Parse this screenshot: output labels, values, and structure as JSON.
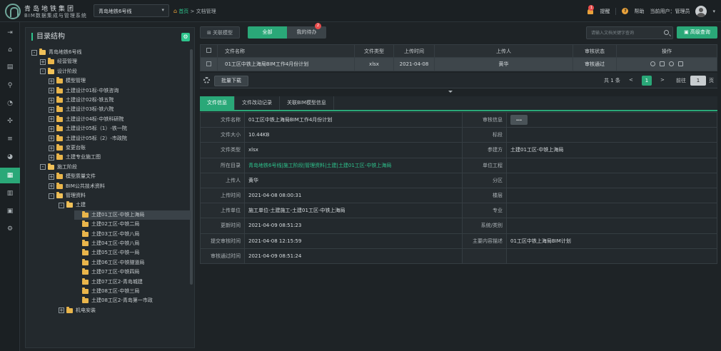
{
  "header": {
    "brand_cn": "青岛地铁集团",
    "brand_sub": "BIM数据集成与管理系统",
    "project": "青岛地铁6号线",
    "breadcrumb": {
      "home": "首页",
      "sep": ">",
      "current": "文档管理"
    },
    "notify_count": "1",
    "notify_label": "提醒",
    "help_label": "帮助",
    "user_label": "当前用户：管理员"
  },
  "rail": {
    "items": [
      "menu-icon",
      "home-icon",
      "chart-icon",
      "flow-icon",
      "gauge-icon",
      "sliders-icon",
      "pie-icon",
      "doc-icon",
      "bar-icon",
      "image-icon",
      "settings-icon"
    ],
    "active_index": 7
  },
  "tree": {
    "title": "目录结构",
    "nodes": [
      {
        "label": "青岛地铁6号线",
        "level": 0,
        "toggle": "-",
        "open": true
      },
      {
        "label": "经营管理",
        "level": 1,
        "toggle": "+"
      },
      {
        "label": "设计阶段",
        "level": 1,
        "toggle": "-",
        "open": true
      },
      {
        "label": "模型管理",
        "level": 2,
        "toggle": "+"
      },
      {
        "label": "土建设计01标-中铁咨询",
        "level": 2,
        "toggle": "+"
      },
      {
        "label": "土建设计02标-铁五院",
        "level": 2,
        "toggle": "+"
      },
      {
        "label": "土建设计03标-铁六院",
        "level": 2,
        "toggle": "+"
      },
      {
        "label": "土建设计04标-中铁科研院",
        "level": 2,
        "toggle": "+"
      },
      {
        "label": "土建设计05标（1）-铁一院",
        "level": 2,
        "toggle": "+"
      },
      {
        "label": "土建设计05标（2）-市政院",
        "level": 2,
        "toggle": "+"
      },
      {
        "label": "变更台账",
        "level": 2,
        "toggle": "+"
      },
      {
        "label": "土建专业施工图",
        "level": 2,
        "toggle": "+"
      },
      {
        "label": "施工阶段",
        "level": 1,
        "toggle": "-",
        "open": true
      },
      {
        "label": "模型质量文件",
        "level": 2,
        "toggle": "+"
      },
      {
        "label": "BIM公共技术资料",
        "level": 2,
        "toggle": "+"
      },
      {
        "label": "管理资料",
        "level": 2,
        "toggle": "-",
        "open": true
      },
      {
        "label": "土建",
        "level": 3,
        "toggle": "-",
        "open": true
      },
      {
        "label": "土建01工区-中铁上海局",
        "level": 4,
        "selected": true
      },
      {
        "label": "土建02工区-中铁二局",
        "level": 4
      },
      {
        "label": "土建03工区-中铁八局",
        "level": 4
      },
      {
        "label": "土建04工区-中铁八局",
        "level": 4
      },
      {
        "label": "土建05工区-中铁一局",
        "level": 4
      },
      {
        "label": "土建06工区-中铁隧道局",
        "level": 4
      },
      {
        "label": "土建07工区-中铁四局",
        "level": 4
      },
      {
        "label": "土建07工区2-青岛城建",
        "level": 4
      },
      {
        "label": "土建08工区-中铁三局",
        "level": 4
      },
      {
        "label": "土建08工区2-青岛第一市政",
        "level": 4
      },
      {
        "label": "机电安装",
        "level": 3,
        "toggle": "+"
      }
    ]
  },
  "toolbar": {
    "link_model": "关联模型",
    "seg_all": "全部",
    "seg_mine": "我的待办",
    "mine_count": "2",
    "search_placeholder": "请输入文档关键字查询",
    "advanced": "高级查询"
  },
  "grid": {
    "columns": [
      "文件名称",
      "文件类型",
      "上传时间",
      "上传人",
      "审核状态",
      "操作"
    ],
    "rows": [
      {
        "name": "01工区中铁上海局BIM工作4月份计划",
        "type": "xlsx",
        "time": "2021-04-08",
        "uploader": "黄华",
        "status": "审核通过"
      }
    ]
  },
  "pager": {
    "batch_download": "批量下载",
    "total": "共 1 条",
    "prev": "<",
    "current": "1",
    "next": ">",
    "goto": "前往",
    "page_input": "1",
    "page_unit": "页"
  },
  "detail_tabs": [
    "文件信息",
    "文件改动记录",
    "关联BIM模型信息"
  ],
  "info": {
    "rows": [
      {
        "k1": "文件名称",
        "v1": "01工区中铁上海局BIM工作4月份计划",
        "k2": "审核信息",
        "v2": "..."
      },
      {
        "k1": "文件大小",
        "v1": "10.44KB",
        "k2": "标段",
        "v2": ""
      },
      {
        "k1": "文件类型",
        "v1": "xlsx",
        "k2": "参建方",
        "v2": "土建01工区-中铁上海局"
      },
      {
        "k1": "所在目录",
        "v1": "青岛地铁6号线|施工阶段|管理资料|土建|土建01工区-中铁上海局",
        "k2": "单位工程",
        "v2": ""
      },
      {
        "k1": "上传人",
        "v1": "黄华",
        "k2": "分区",
        "v2": ""
      },
      {
        "k1": "上传时间",
        "v1": "2021-04-08 08:00:31",
        "k2": "楼层",
        "v2": ""
      },
      {
        "k1": "上传单位",
        "v1": "施工单位-土建施工-土建01工区-中铁上海局",
        "k2": "专业",
        "v2": ""
      },
      {
        "k1": "更新时间",
        "v1": "2021-04-09 08:51:23",
        "k2": "系统/类别",
        "v2": ""
      },
      {
        "k1": "提交审核时间",
        "v1": "2021-04-08 12:15:59",
        "k2": "主要内容描述",
        "v2": "01工区中铁上海局BIM计划"
      },
      {
        "k1": "审核通过时间",
        "v1": "2021-04-09 08:51:24",
        "k2": "",
        "v2": ""
      }
    ]
  }
}
